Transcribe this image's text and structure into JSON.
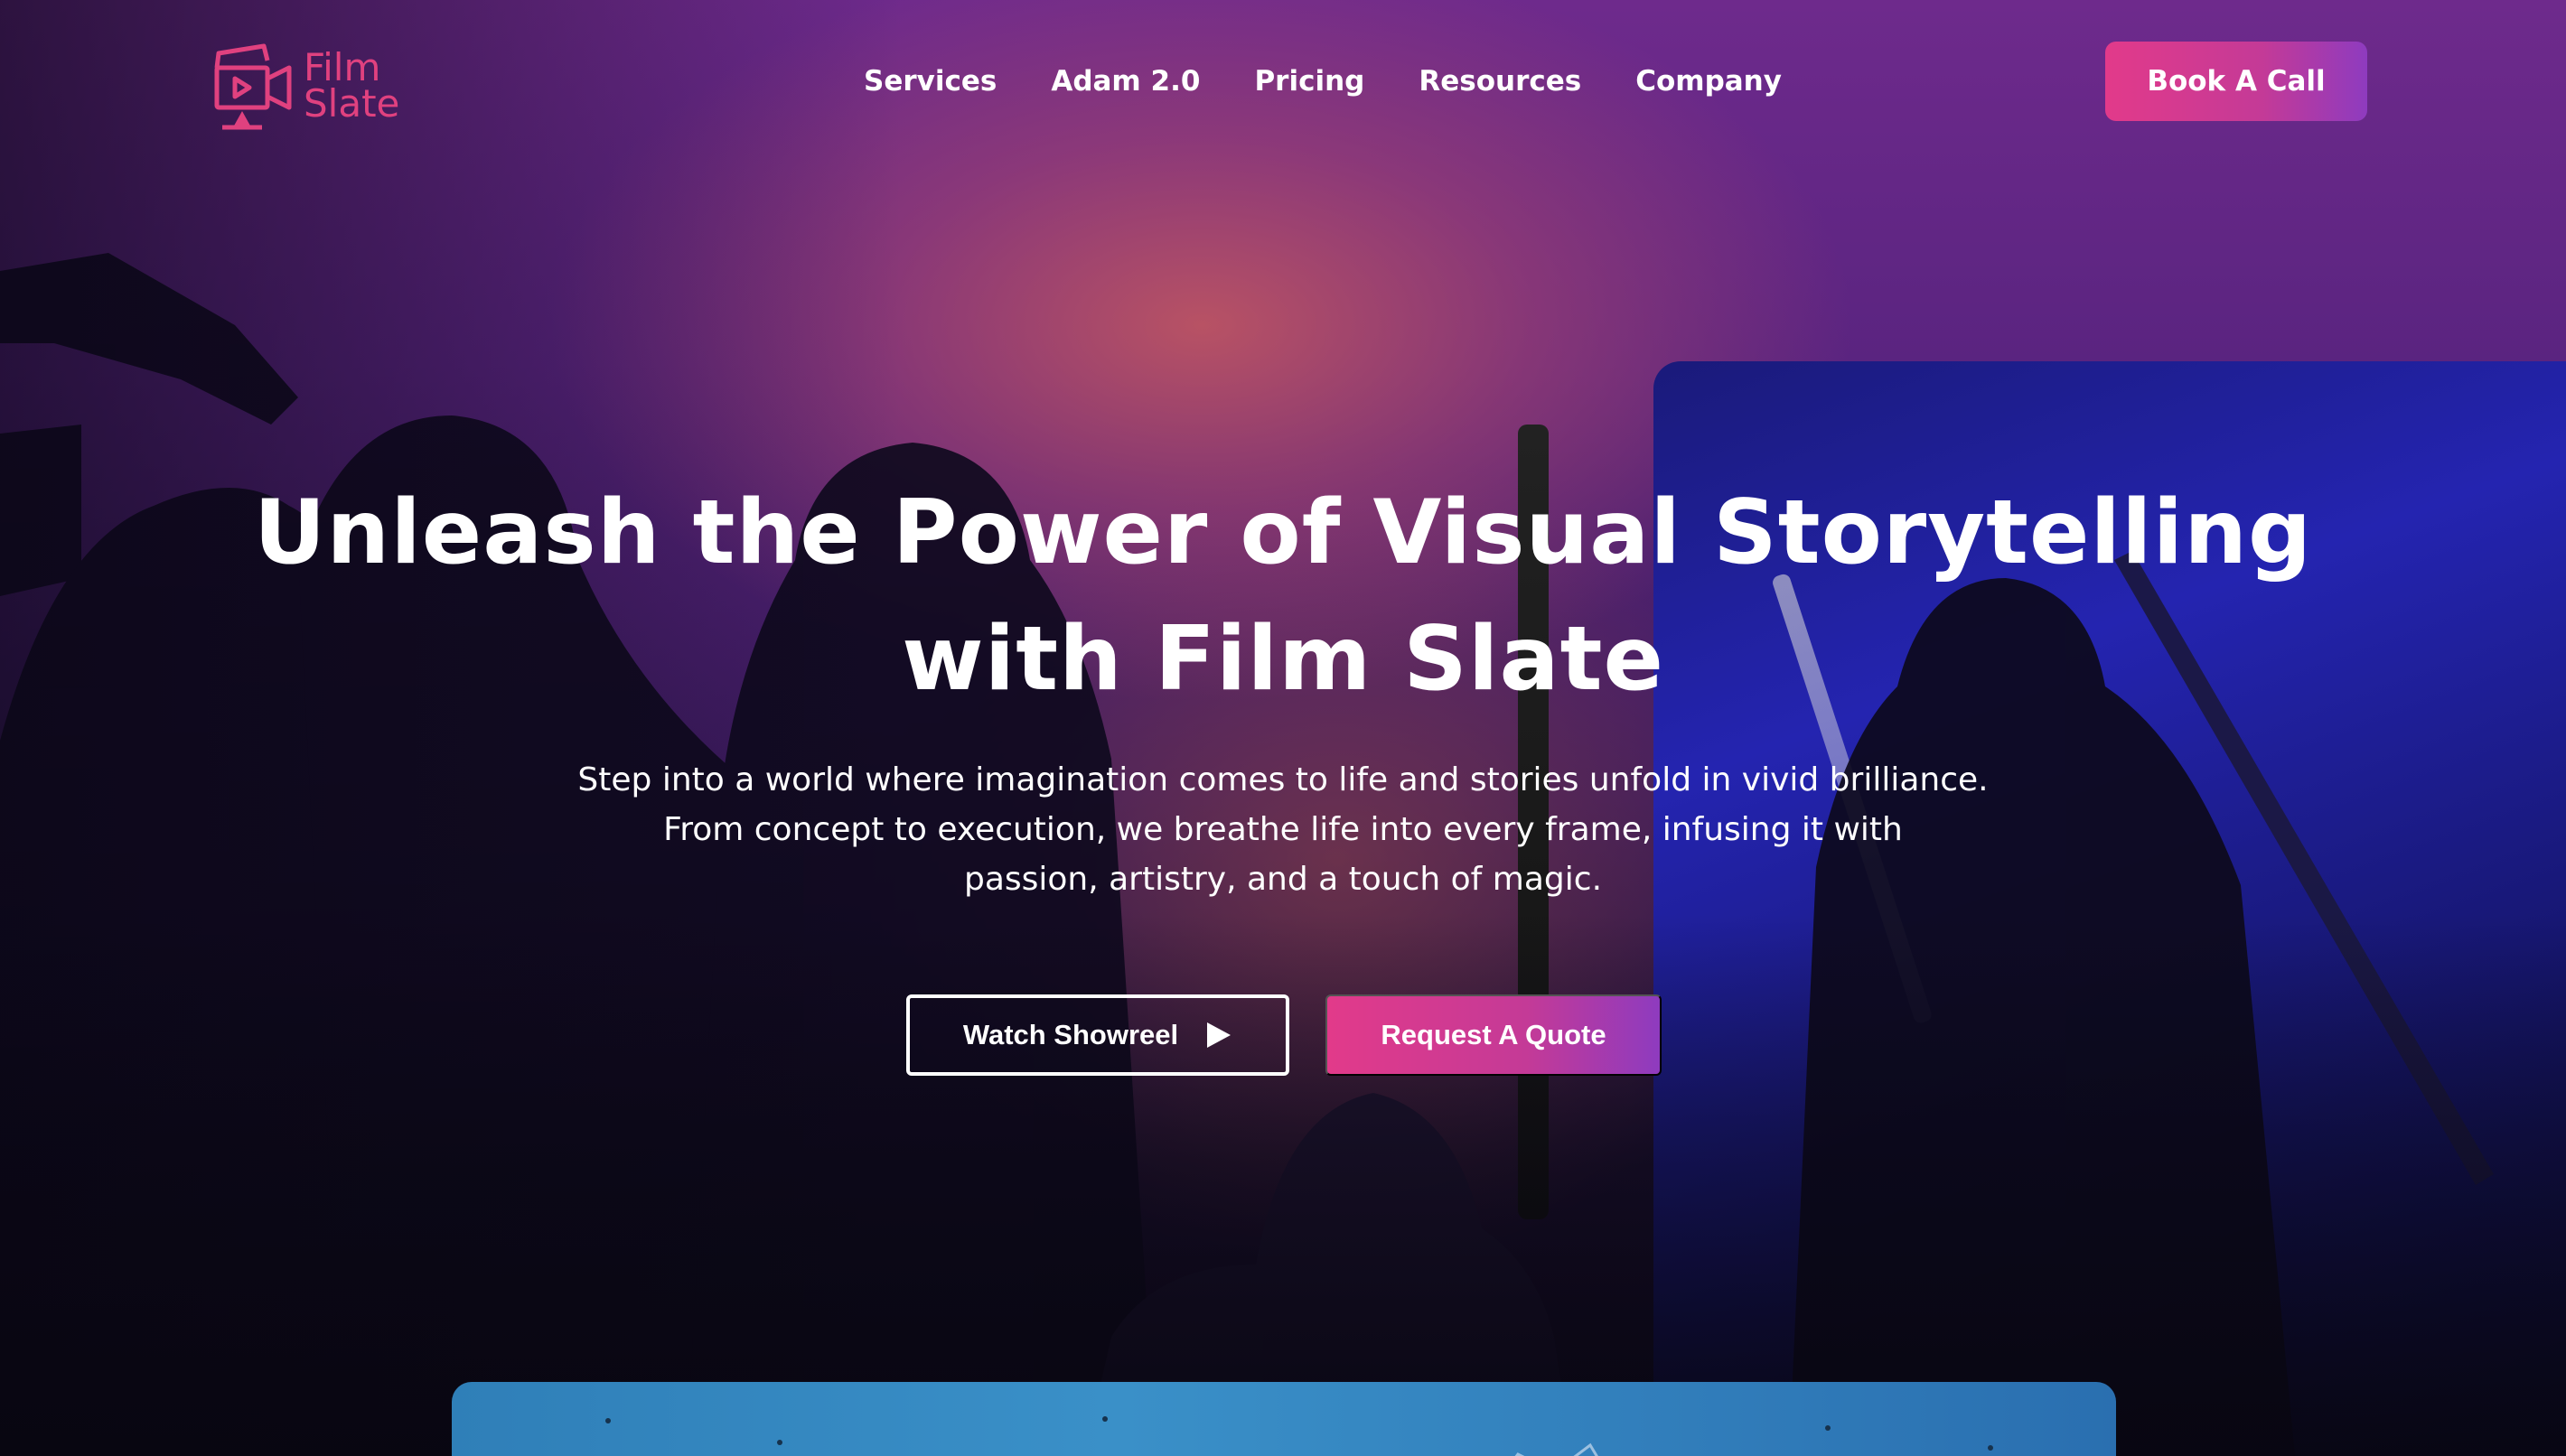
{
  "brand": {
    "logo_line1": "Film",
    "logo_line2": "Slate",
    "logo_color": "#e0417f"
  },
  "nav": {
    "items": [
      {
        "label": "Services"
      },
      {
        "label": "Adam 2.0"
      },
      {
        "label": "Pricing"
      },
      {
        "label": "Resources"
      },
      {
        "label": "Company"
      }
    ],
    "cta_label": "Book A Call"
  },
  "hero": {
    "headline_line1": "Unleash the Power of Visual Storytelling",
    "headline_line2": "with Film Slate",
    "sub_line1": "Step into a world where imagination comes to life and stories unfold in vivid brilliance.",
    "sub_line2": "From concept to execution, we breathe life into every frame, infusing it with",
    "sub_line3": "passion, artistry, and a touch of magic.",
    "secondary_button": "Watch Showreel",
    "secondary_button_icon": "play-icon",
    "primary_button": "Request A Quote"
  },
  "colors": {
    "accent_start": "#e23a8a",
    "accent_end": "#8e3bbf",
    "preview_blue": "#3a90c8"
  }
}
